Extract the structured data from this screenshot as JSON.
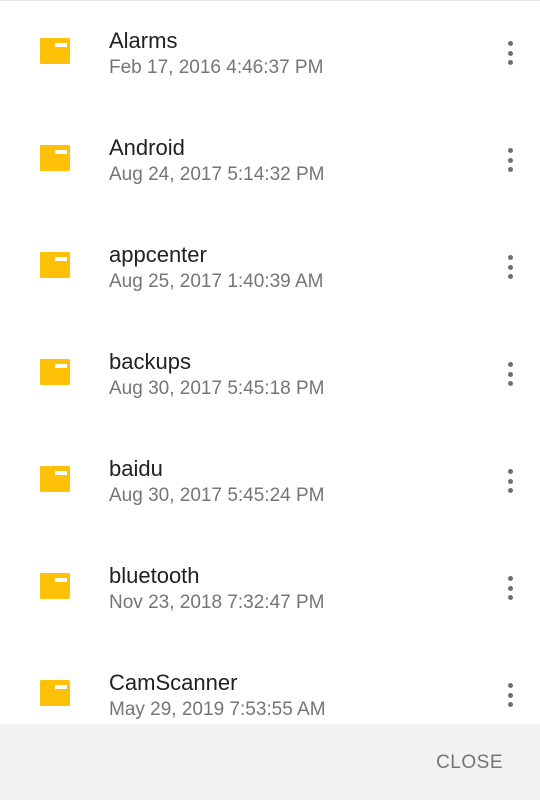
{
  "files": [
    {
      "name": "Alarms",
      "date": "Feb 17, 2016 4:46:37 PM",
      "icon": "folder-icon",
      "menu_icon": "more-vert-icon"
    },
    {
      "name": "Android",
      "date": "Aug 24, 2017 5:14:32 PM",
      "icon": "folder-icon",
      "menu_icon": "more-vert-icon"
    },
    {
      "name": "appcenter",
      "date": "Aug 25, 2017 1:40:39 AM",
      "icon": "folder-icon",
      "menu_icon": "more-vert-icon"
    },
    {
      "name": "backups",
      "date": "Aug 30, 2017 5:45:18 PM",
      "icon": "folder-icon",
      "menu_icon": "more-vert-icon"
    },
    {
      "name": "baidu",
      "date": "Aug 30, 2017 5:45:24 PM",
      "icon": "folder-icon",
      "menu_icon": "more-vert-icon"
    },
    {
      "name": "bluetooth",
      "date": "Nov 23, 2018 7:32:47 PM",
      "icon": "folder-icon",
      "menu_icon": "more-vert-icon"
    },
    {
      "name": "CamScanner",
      "date": "May 29, 2019 7:53:55 AM",
      "icon": "folder-icon",
      "menu_icon": "more-vert-icon"
    }
  ],
  "footer": {
    "close_label": "CLOSE"
  },
  "colors": {
    "folder": "#FFC107",
    "folder_tab": "#FFFFFF",
    "footer_bg": "#F2F2F2",
    "primary_text": "#212121",
    "secondary_text": "#757575"
  }
}
